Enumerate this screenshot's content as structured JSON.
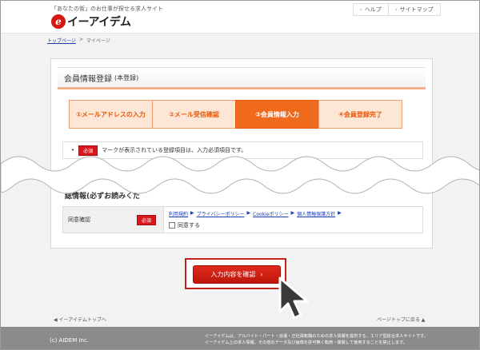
{
  "header": {
    "tagline": "「あなたの街」のお仕事が探せる求人サイト",
    "logo_mark": "e",
    "logo_text": "イーアイデム",
    "nav": [
      {
        "label": "ヘルプ"
      },
      {
        "label": "サイトマップ"
      }
    ]
  },
  "breadcrumb": {
    "home": "トップページ",
    "separator": ">",
    "current": "マイページ"
  },
  "form": {
    "title": "会員情報登録",
    "title_sub": "(本登録)",
    "steps": [
      {
        "label": "①メールアドレスの入力"
      },
      {
        "label": "②メール受信確認"
      },
      {
        "label": "③会員情報入力"
      },
      {
        "label": "④会員登録完了"
      }
    ],
    "notice_bullet": "•",
    "required_badge": "必須",
    "notice_text": "マークが表示されている登録項目は、入力必須項目です。",
    "agreement_heading": "総情報(必ずお読みくだ",
    "agreement_label": "同意確認",
    "agreement_links": [
      {
        "label": "利用規約"
      },
      {
        "label": "プライバシーポリシー"
      },
      {
        "label": "Cookieポリシー"
      },
      {
        "label": "個人情報保護方針"
      }
    ],
    "link_separator": "▶",
    "agree_checkbox_label": "同意する",
    "confirm_button_label": "入力内容を確認",
    "confirm_button_arrow": "›"
  },
  "footer_nav": {
    "left": "◀ イーアイデムトップへ",
    "right": "ページトップに戻る ▲"
  },
  "footer": {
    "copyright": "(c) AIDEM Inc.",
    "description_line1": "イーアイデムは、アルバイト・パート・派遣・正社員転職のための求人情報を提供する、エリア型総合求人サイトです。",
    "description_line2": "イーアイデム上の求人情報、その他のデータ及び画像を許可無く転用・複製して使用することを禁止します。"
  },
  "colors": {
    "brand_red": "#d31a12",
    "accent_orange": "#f06a1e",
    "step_bg": "#fde6d6",
    "footer_gray": "#8b8b8b"
  }
}
